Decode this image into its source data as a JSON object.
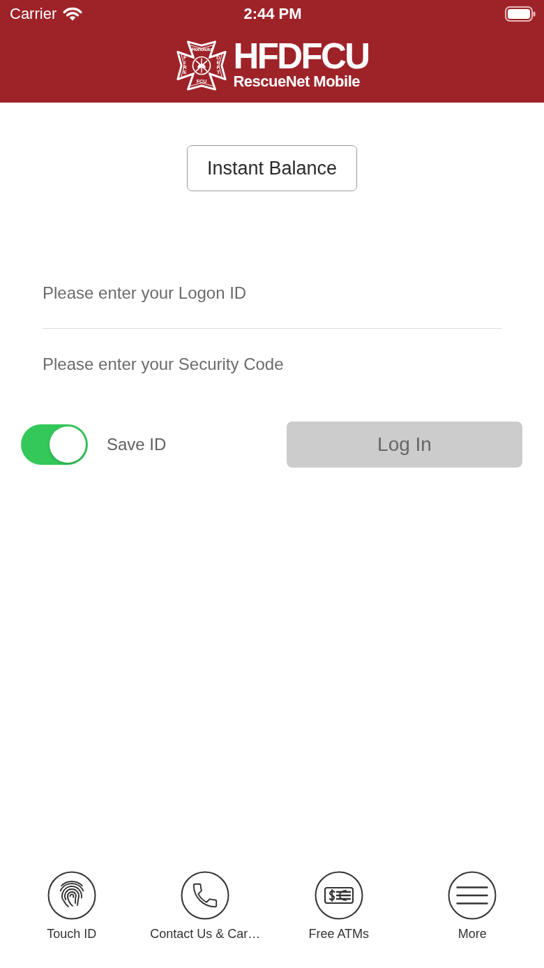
{
  "status_bar": {
    "carrier": "Carrier",
    "time": "2:44 PM"
  },
  "header": {
    "logo": {
      "emblem_texts": [
        {
          "kind": "top",
          "text": "Honolulu"
        },
        {
          "kind": "left",
          "text": "FIRE"
        },
        {
          "kind": "right",
          "text": "DEPT"
        },
        {
          "kind": "bottom",
          "text": "FCU"
        }
      ],
      "title": "HFDFCU",
      "subtitle": "RescueNet Mobile"
    }
  },
  "instant_balance_button": {
    "label": "Instant Balance"
  },
  "login_form": {
    "fields": [
      {
        "placeholder": "Please enter your Logon ID"
      },
      {
        "placeholder": "Please enter your Security Code"
      }
    ],
    "save_id": {
      "label": "Save ID",
      "on": true
    },
    "login_button": {
      "label": "Log In",
      "disabled": true
    }
  },
  "bottom_bar": {
    "items": [
      {
        "kind": "fingerprint",
        "label": "Touch ID"
      },
      {
        "kind": "phone",
        "label": "Contact Us & Car…"
      },
      {
        "kind": "banknote",
        "label": "Free ATMs"
      },
      {
        "kind": "menu",
        "label": "More"
      }
    ]
  }
}
